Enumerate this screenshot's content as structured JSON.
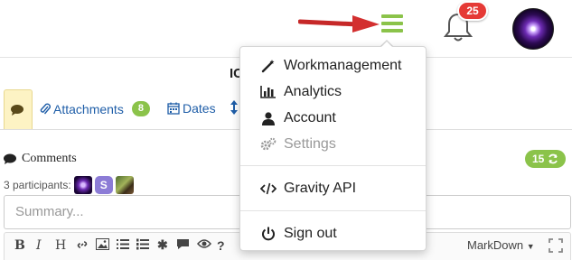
{
  "header": {
    "notifications_count": "25"
  },
  "page": {
    "title_visible": "IC"
  },
  "tabs": {
    "attachments_label": "Attachments",
    "attachments_count": "8",
    "dates_label": "Dates"
  },
  "comments": {
    "title": "Comments",
    "count": "15",
    "participants_label": "3 participants:",
    "participant_letter": "S",
    "summary_placeholder": "Summary...",
    "editor_mode": "MarkDown"
  },
  "menu": {
    "items": [
      {
        "label": "Workmanagement",
        "icon": "magic-wand-icon"
      },
      {
        "label": "Analytics",
        "icon": "bar-chart-icon"
      },
      {
        "label": "Account",
        "icon": "user-icon"
      },
      {
        "label": "Settings",
        "icon": "gears-icon"
      },
      {
        "label": "Gravity API",
        "icon": "code-icon"
      },
      {
        "label": "Sign out",
        "icon": "power-icon"
      }
    ]
  },
  "colors": {
    "accent_green": "#8bc34a",
    "badge_red": "#e53935",
    "link_blue": "#1f5ea8",
    "active_tab": "#fdf3c4"
  }
}
